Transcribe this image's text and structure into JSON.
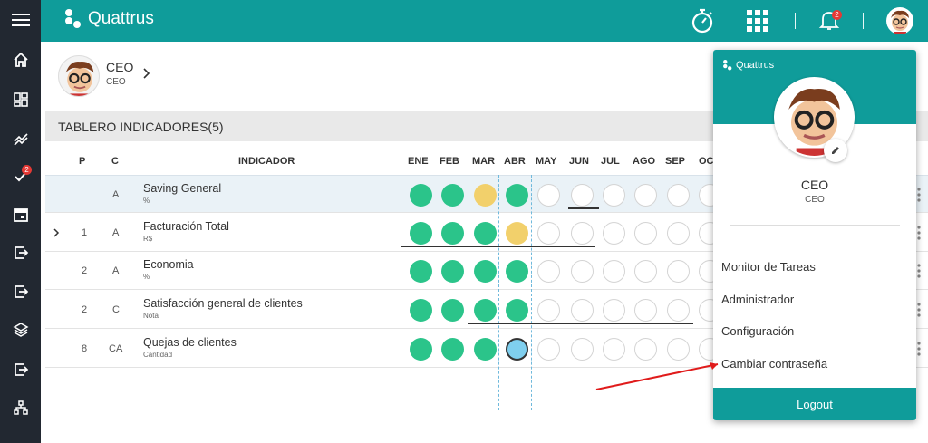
{
  "app": {
    "name": "Quattrus",
    "notification_count": "2",
    "sidebar_badge": "2"
  },
  "sidebar": {
    "icons": [
      "menu-icon",
      "home-icon",
      "dashboard-icon",
      "trend-icon",
      "check-icon",
      "calendar-icon",
      "exit-icon",
      "exit-icon",
      "layers-icon",
      "exit-icon",
      "hierarchy-icon"
    ]
  },
  "profile": {
    "name": "CEO",
    "role": "CEO"
  },
  "panel": {
    "title": "TABLERO INDICADORES(5)"
  },
  "table": {
    "headers": {
      "p": "P",
      "c": "C",
      "indicador": "INDICADOR"
    },
    "months": [
      "ENE",
      "FEB",
      "MAR",
      "ABR",
      "MAY",
      "JUN",
      "JUL",
      "AGO",
      "SEP",
      "OC"
    ],
    "rows": [
      {
        "p": "",
        "c": "A",
        "name": "Saving General",
        "unit": "%",
        "status": [
          "green",
          "green",
          "yellow",
          "green",
          "empty",
          "empty",
          "empty",
          "empty",
          "empty",
          "empty"
        ]
      },
      {
        "p": "1",
        "c": "A",
        "name": "Facturación Total",
        "unit": "R$",
        "status": [
          "green",
          "green",
          "green",
          "yellow",
          "empty",
          "empty",
          "empty",
          "empty",
          "empty",
          "empty"
        ]
      },
      {
        "p": "2",
        "c": "A",
        "name": "Economia",
        "unit": "%",
        "status": [
          "green",
          "green",
          "green",
          "green",
          "empty",
          "empty",
          "empty",
          "empty",
          "empty",
          "empty"
        ]
      },
      {
        "p": "2",
        "c": "C",
        "name": "Satisfacción general de clientes",
        "unit": "Nota",
        "status": [
          "green",
          "green",
          "green",
          "green",
          "empty",
          "empty",
          "empty",
          "empty",
          "empty",
          "empty"
        ]
      },
      {
        "p": "8",
        "c": "CA",
        "name": "Quejas de clientes",
        "unit": "Cantidad",
        "status": [
          "green",
          "green",
          "green",
          "blue",
          "empty",
          "empty",
          "empty",
          "empty",
          "empty",
          "empty"
        ]
      }
    ]
  },
  "dropdown": {
    "brand": "Quattrus",
    "name": "CEO",
    "role": "CEO",
    "items": [
      "Monitor de Tareas",
      "Administrador",
      "Configuración",
      "Cambiar contraseña"
    ],
    "logout": "Logout"
  },
  "colors": {
    "primary": "#0f9c9a",
    "sidebar": "#222831",
    "status_green": "#2bc48a",
    "status_yellow": "#f2d06b",
    "status_blue": "#7fcfee",
    "annotation_arrow": "#e01b1b"
  }
}
